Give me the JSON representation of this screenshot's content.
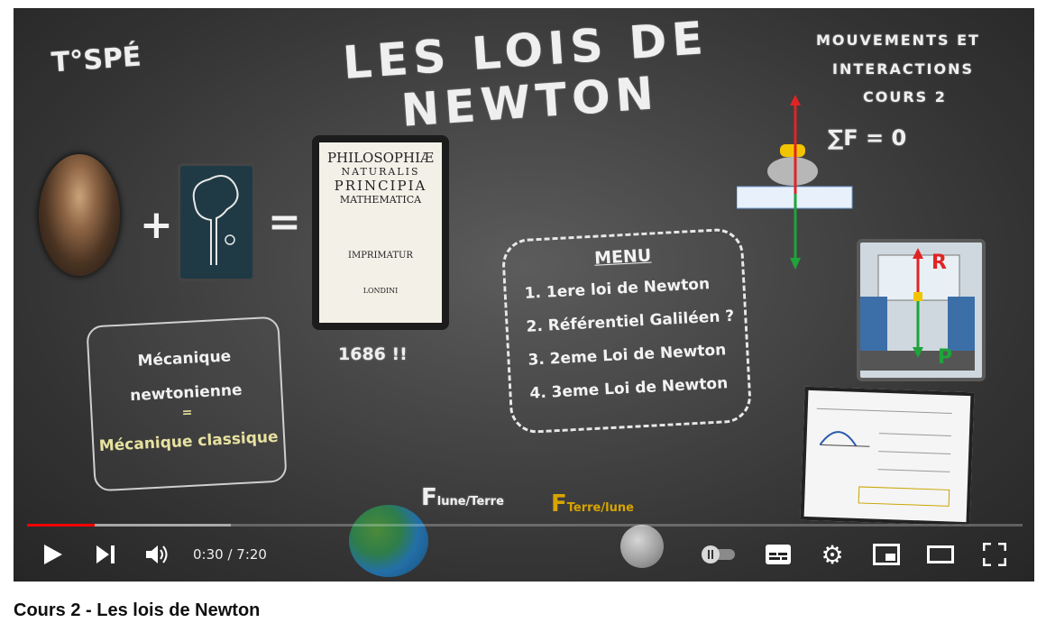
{
  "video": {
    "slide": {
      "header_left": "T°SPÉ",
      "title_line1": "LES LOIS DE",
      "title_line2": "NEWTON",
      "header_right": [
        "MOUVEMENTS ET",
        "INTERACTIONS",
        "COURS 2"
      ],
      "plus": "+",
      "equals": "=",
      "book": {
        "l1": "PHILOSOPHIÆ",
        "l2": "NATURALIS",
        "l3": "PRINCIPIA",
        "l4": "MATHEMATICA",
        "l5": "IMPRIMATUR",
        "l6": "LONDINI"
      },
      "year": "1686 !!",
      "meca": {
        "line1": "Mécanique",
        "line2": "newtonienne",
        "line3": "=",
        "line4": "Mécanique classique"
      },
      "menu": {
        "title": "MENU",
        "items": [
          "1. 1ere loi de Newton",
          "2. Référentiel Galiléen ?",
          "3. 2eme Loi de Newton",
          "4. 3eme Loi de Newton"
        ]
      },
      "sum_formula": "∑F = 0",
      "vec_r": "R",
      "vec_p": "P",
      "force_lune_terre": {
        "main": "F",
        "sub": "lune/Terre"
      },
      "force_terre_lune": {
        "main": "F",
        "sub": "Terre/lune"
      }
    },
    "controls": {
      "time_current": "0:30",
      "time_total": "7:20",
      "time_sep": " / ",
      "progress_played": 0.0679,
      "progress_buffered": 0.205,
      "icons": [
        "play-icon",
        "next-icon",
        "volume-icon",
        "autoplay-toggle-icon",
        "subtitles-icon",
        "settings-icon",
        "miniplayer-icon",
        "theater-icon",
        "fullscreen-icon"
      ]
    },
    "title": "Cours 2 - Les lois de Newton"
  },
  "colors": {
    "red": "#ff0000",
    "chalk": "#efefef",
    "board": "#3a3a3a"
  }
}
